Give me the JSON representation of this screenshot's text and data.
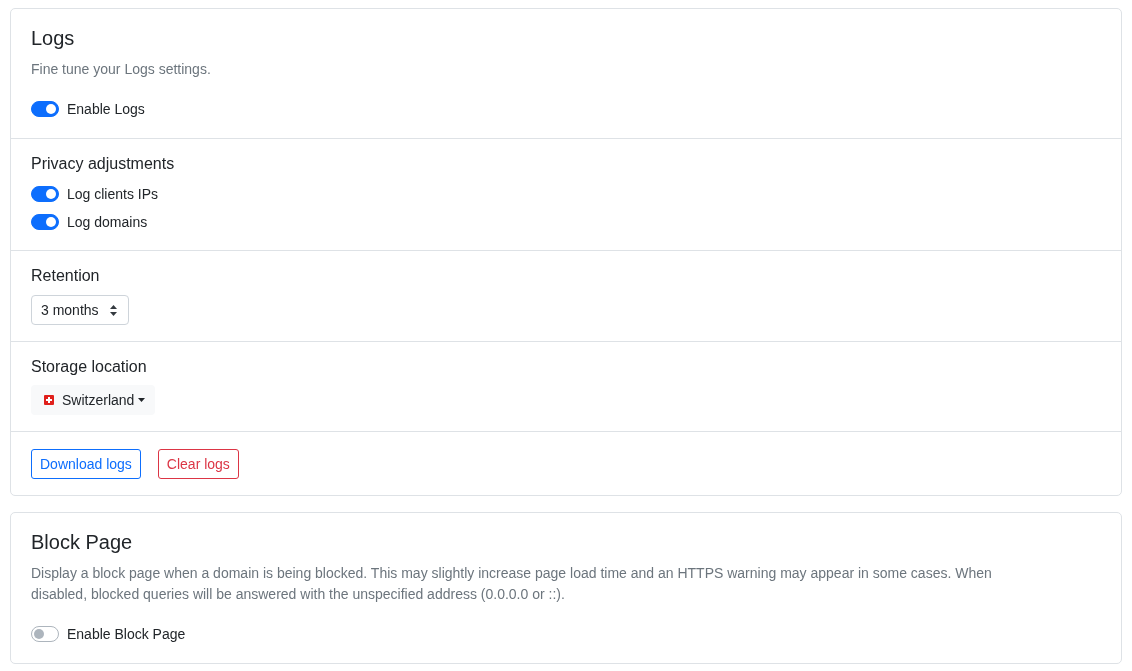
{
  "cards": [
    {
      "sections": [
        {
          "title": "Logs",
          "description": "Fine tune your Logs settings.",
          "toggles": [
            {
              "label": "Enable Logs",
              "on": true
            }
          ]
        },
        {
          "heading": "Privacy adjustments",
          "toggles": [
            {
              "label": "Log clients IPs",
              "on": true
            },
            {
              "label": "Log domains",
              "on": true
            }
          ]
        },
        {
          "heading": "Retention",
          "select": {
            "value": "3 months"
          }
        },
        {
          "heading": "Storage location",
          "dropdown": {
            "value": "Switzerland"
          }
        },
        {
          "buttons": [
            {
              "label": "Download logs",
              "kind": "primary"
            },
            {
              "label": "Clear logs",
              "kind": "danger"
            }
          ]
        }
      ]
    },
    {
      "sections": [
        {
          "title": "Block Page",
          "description": "Display a block page when a domain is being blocked. This may slightly increase page load time and an HTTPS warning may appear in some cases. When disabled, blocked queries will be answered with the unspecified address (0.0.0.0 or ::).",
          "toggles": [
            {
              "label": "Enable Block Page",
              "on": false
            }
          ]
        }
      ]
    }
  ]
}
